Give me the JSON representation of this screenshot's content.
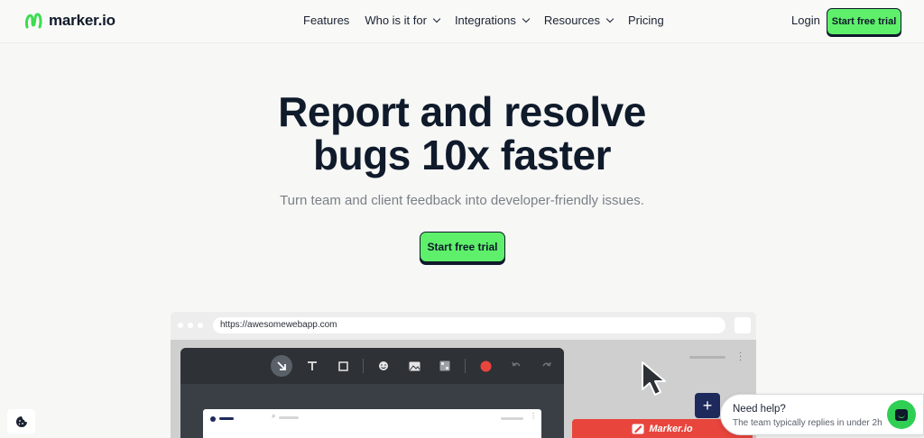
{
  "header": {
    "logo_text": "marker.io",
    "nav": [
      {
        "label": "Features",
        "dropdown": false
      },
      {
        "label": "Who is it for",
        "dropdown": true
      },
      {
        "label": "Integrations",
        "dropdown": true
      },
      {
        "label": "Resources",
        "dropdown": true
      },
      {
        "label": "Pricing",
        "dropdown": false
      }
    ],
    "login_label": "Login",
    "cta_label": "Start free trial"
  },
  "hero": {
    "title_line1": "Report and resolve",
    "title_line2": "bugs 10x faster",
    "subtitle": "Turn team and client feedback into developer-friendly issues.",
    "cta_label": "Start free trial"
  },
  "browser_mock": {
    "url": "https://awesomewebapp.com",
    "toolbar_icons": [
      "arrow-icon",
      "text-icon",
      "rectangle-icon",
      "emoji-icon",
      "image-icon",
      "blur-icon",
      "color-icon",
      "undo-icon",
      "redo-icon"
    ],
    "widget_brand": "Marker.io"
  },
  "chat": {
    "title": "Need help?",
    "subtitle": "The team typically replies in under 2h"
  },
  "colors": {
    "accent_green": "#5ef06a",
    "text_dark": "#0f1a2b",
    "marker_red": "#e8453c",
    "navy": "#1f2a5c",
    "chat_green": "#2fcf53"
  }
}
